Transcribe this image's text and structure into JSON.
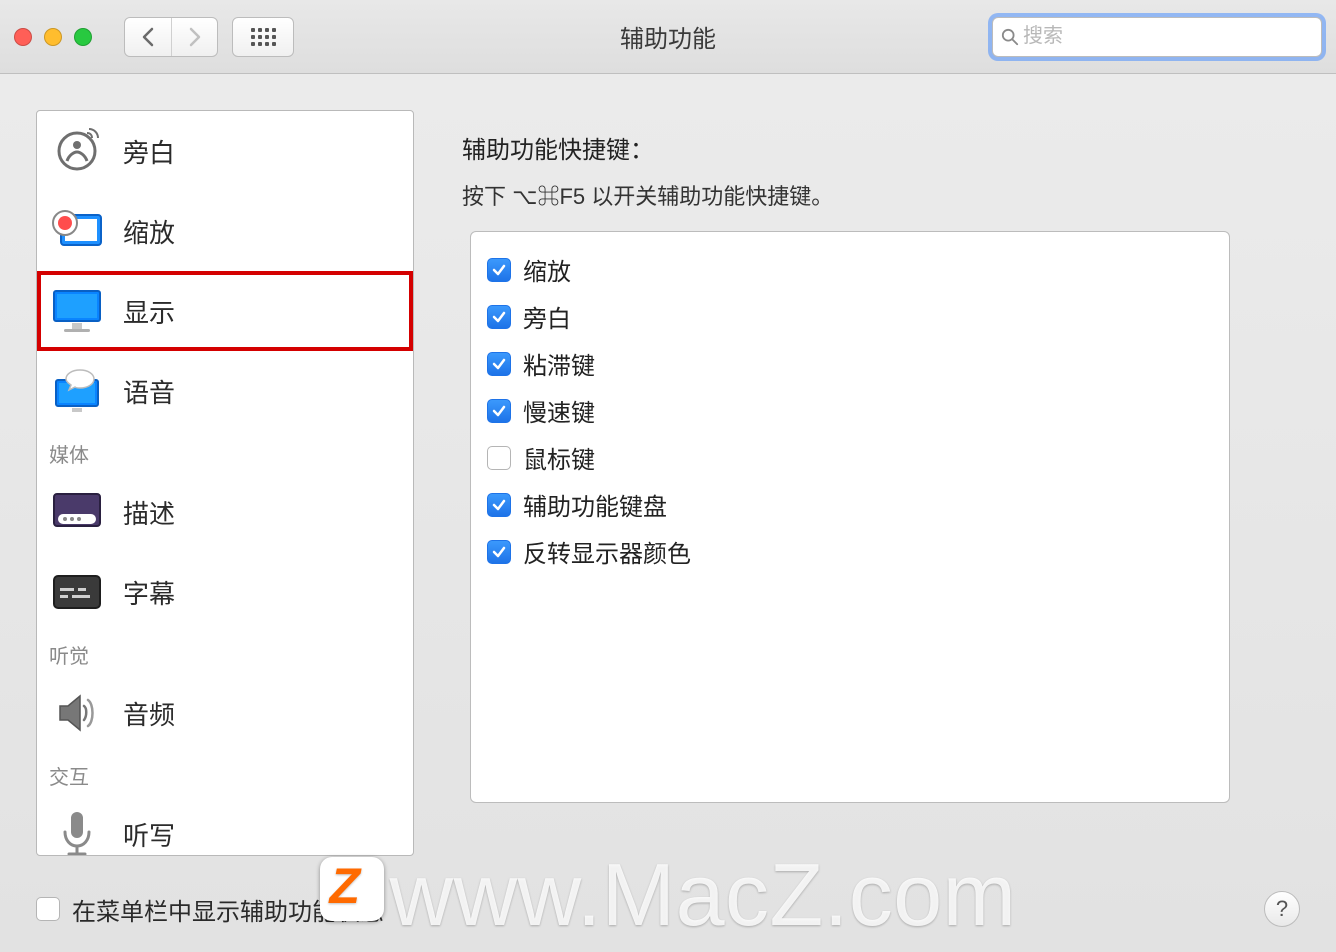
{
  "window": {
    "title": "辅助功能"
  },
  "search": {
    "placeholder": "搜索"
  },
  "sidebar": {
    "items": [
      {
        "label": "旁白"
      },
      {
        "label": "缩放"
      },
      {
        "label": "显示"
      },
      {
        "label": "语音"
      }
    ],
    "section_media": "媒体",
    "media_items": [
      {
        "label": "描述"
      },
      {
        "label": "字幕"
      }
    ],
    "section_hearing": "听觉",
    "hearing_items": [
      {
        "label": "音频"
      }
    ],
    "section_interact": "交互",
    "interact_items": [
      {
        "label": "听写"
      }
    ]
  },
  "main": {
    "heading": "辅助功能快捷键：",
    "subhead": "按下 ⌥⌘F5 以开关辅助功能快捷键。",
    "options": [
      {
        "label": "缩放",
        "checked": true
      },
      {
        "label": "旁白",
        "checked": true
      },
      {
        "label": "粘滞键",
        "checked": true
      },
      {
        "label": "慢速键",
        "checked": true
      },
      {
        "label": "鼠标键",
        "checked": false
      },
      {
        "label": "辅助功能键盘",
        "checked": true
      },
      {
        "label": "反转显示器颜色",
        "checked": true
      }
    ]
  },
  "footer": {
    "menubar_label": "在菜单栏中显示辅助功能状态",
    "watermark": "www.MacZ.com"
  }
}
